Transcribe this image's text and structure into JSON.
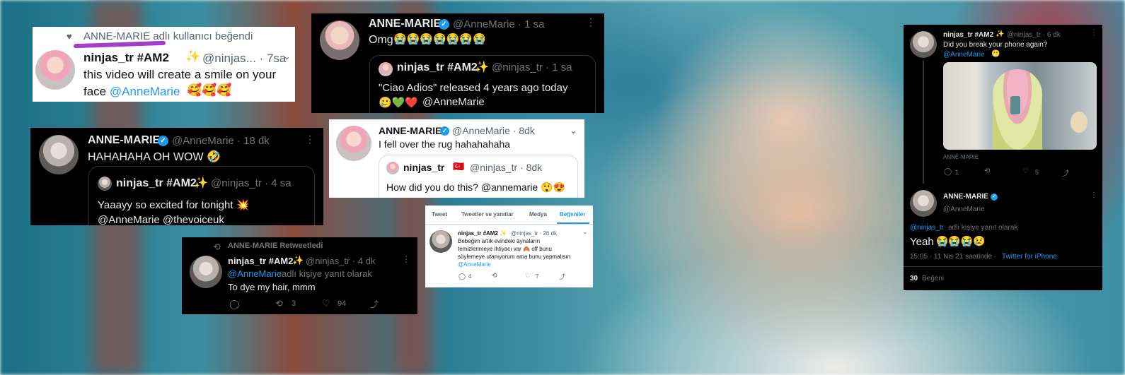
{
  "card1": {
    "liked_by": "ANNE-MARIE adlı kullanıcı beğendi",
    "name": "ninjas_tr #AM2",
    "handle_time": "@ninjas... · 7sa",
    "text_line1": "this video will create a smile on your",
    "text_line2_mention": "face @AnneMarie",
    "emojis": "🥰🥰🥰"
  },
  "card2": {
    "name": "ANNE-MARIE",
    "handle_time": "@AnneMarie · 1 sa",
    "text": "Omg",
    "emojis": "😭😭😭😭😭😭😭",
    "quote": {
      "name": "ninjas_tr #AM2",
      "handle_time": "@ninjas_tr · 1 sa",
      "line1": "\"Ciao Adios\" released 4 years ago today",
      "line2_emojis": "🥲💚❤️",
      "line2_mention": "@AnneMarie"
    }
  },
  "card3": {
    "name": "ANNE-MARIE",
    "handle_time": "@AnneMarie · 18 dk",
    "text": "HAHAHAHA OH WOW 🤣",
    "quote": {
      "name": "ninjas_tr #AM2",
      "handle_time": "@ninjas_tr · 4 sa",
      "line1": "Yaaayy so excited for tonight 💥",
      "line2": "@AnneMarie @thevoiceuk"
    }
  },
  "card4": {
    "name": "ANNE-MARIE",
    "handle_time": "@AnneMarie · 8dk",
    "text": "I fell over the rug hahahahaha",
    "quote": {
      "name": "ninjas_tr",
      "flag": "🇹🇷",
      "handle_time": "@ninjas_tr · 8dk",
      "text": "How did you do this? @annemarie 😲😍"
    }
  },
  "card5": {
    "retweeted_by": "ANNE-MARIE Retweetledi",
    "name": "ninjas_tr #AM2",
    "handle_time": "@ninjas_tr · 4 dk",
    "reply_mention": "@AnneMarie",
    "reply_suffix": "adlı kişiye yanıt olarak",
    "text": "To dye my hair, mmm",
    "retweets": "3",
    "likes": "94"
  },
  "card6": {
    "tabs": [
      "Tweet",
      "Tweetler ve yanıtlar",
      "Medya",
      "Beğeniler"
    ],
    "name": "ninjas_tr #AM2 ✨",
    "handle_time": "@ninjas_tr · 26 dk",
    "line1": "Bebeğim artık evindeki aynaların",
    "line2": "temizlenmeye ihtiyacı var 🙈 off bunu",
    "line3": "söylemeye utanıyorum ama bunu yapmalısın",
    "mention": "@AnneMarie",
    "replies": "4",
    "likes": "7"
  },
  "card7": {
    "name": "ninjas_tr #AM2",
    "handle_time": "@ninjas_tr · 6 dk",
    "text": "Did you break your phone again?",
    "mention": "@AnneMarie",
    "emoji": "😬",
    "media_caption": "ANNE-MARIE",
    "replies": "1",
    "likes": "5",
    "reply_name": "ANNE-MARIE",
    "reply_handle": "@AnneMarie",
    "reply_to_mention": "@ninjas_tr",
    "reply_to_suffix": "adlı kişiye yanıt olarak",
    "reply_text": "Yeah",
    "reply_emojis": "😭😭😭😢",
    "timestamp": "15:05 · 11 Nis 21 saatinde ·",
    "source": "Twitter for iPhone",
    "likes_count": "30",
    "likes_label": "Beğeni"
  }
}
